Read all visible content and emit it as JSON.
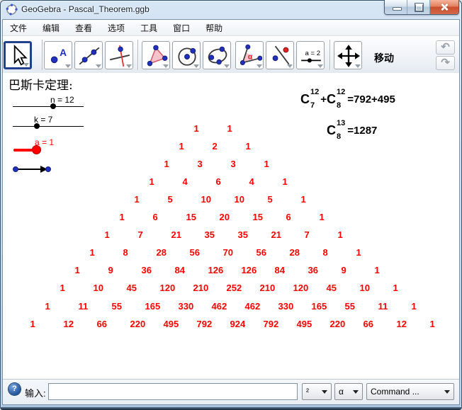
{
  "window": {
    "title": "GeoGebra - Pascal_Theorem.ggb"
  },
  "menu": {
    "items": [
      "文件",
      "编辑",
      "查看",
      "选项",
      "工具",
      "窗口",
      "帮助"
    ]
  },
  "toolbar": {
    "active_tool_label": "移动",
    "point_icon_letter": "A",
    "angle_icon_letter": "α",
    "slider_icon_text": "a = 2",
    "undo_glyph": "↶",
    "redo_glyph": "↷",
    "tool_icons": [
      "move-cursor-icon",
      "point-icon",
      "line-icon",
      "perpendicular-line-icon",
      "polygon-icon",
      "circle-icon",
      "ellipse-icon",
      "angle-icon",
      "reflect-icon",
      "slider-icon",
      "move-canvas-icon"
    ]
  },
  "canvas": {
    "heading": "巴斯卡定理:",
    "sliders": {
      "n": {
        "label": "n = 12",
        "value": 12
      },
      "k": {
        "label": "k = 7",
        "value": 7
      },
      "a": {
        "label": "a = 1",
        "value": 1,
        "color": "#ff0000"
      }
    },
    "formula1": {
      "c1": "C",
      "sup1": "12",
      "sub1": "7",
      "plus": "+",
      "c2": "C",
      "sup2": "12",
      "sub2": "8",
      "rhs": "=792+495"
    },
    "formula2": {
      "c": "C",
      "sup": "13",
      "sub": "8",
      "rhs": "=1287"
    },
    "triangle": {
      "color": "#ff0000",
      "rows": [
        [
          1,
          1
        ],
        [
          1,
          2,
          1
        ],
        [
          1,
          3,
          3,
          1
        ],
        [
          1,
          4,
          6,
          4,
          1
        ],
        [
          1,
          5,
          10,
          10,
          5,
          1
        ],
        [
          1,
          6,
          15,
          20,
          15,
          6,
          1
        ],
        [
          1,
          7,
          21,
          35,
          35,
          21,
          7,
          1
        ],
        [
          1,
          8,
          28,
          56,
          70,
          56,
          28,
          8,
          1
        ],
        [
          1,
          9,
          36,
          84,
          126,
          126,
          84,
          36,
          9,
          1
        ],
        [
          1,
          10,
          45,
          120,
          210,
          252,
          210,
          120,
          45,
          10,
          1
        ],
        [
          1,
          11,
          55,
          165,
          330,
          462,
          462,
          330,
          165,
          55,
          11,
          1
        ],
        [
          1,
          12,
          66,
          220,
          495,
          792,
          924,
          792,
          495,
          220,
          66,
          12,
          1
        ]
      ]
    }
  },
  "inputbar": {
    "help_glyph": "?",
    "label": "输入:",
    "input_value": "",
    "dropdowns": [
      "²",
      "α",
      "Command ..."
    ]
  }
}
